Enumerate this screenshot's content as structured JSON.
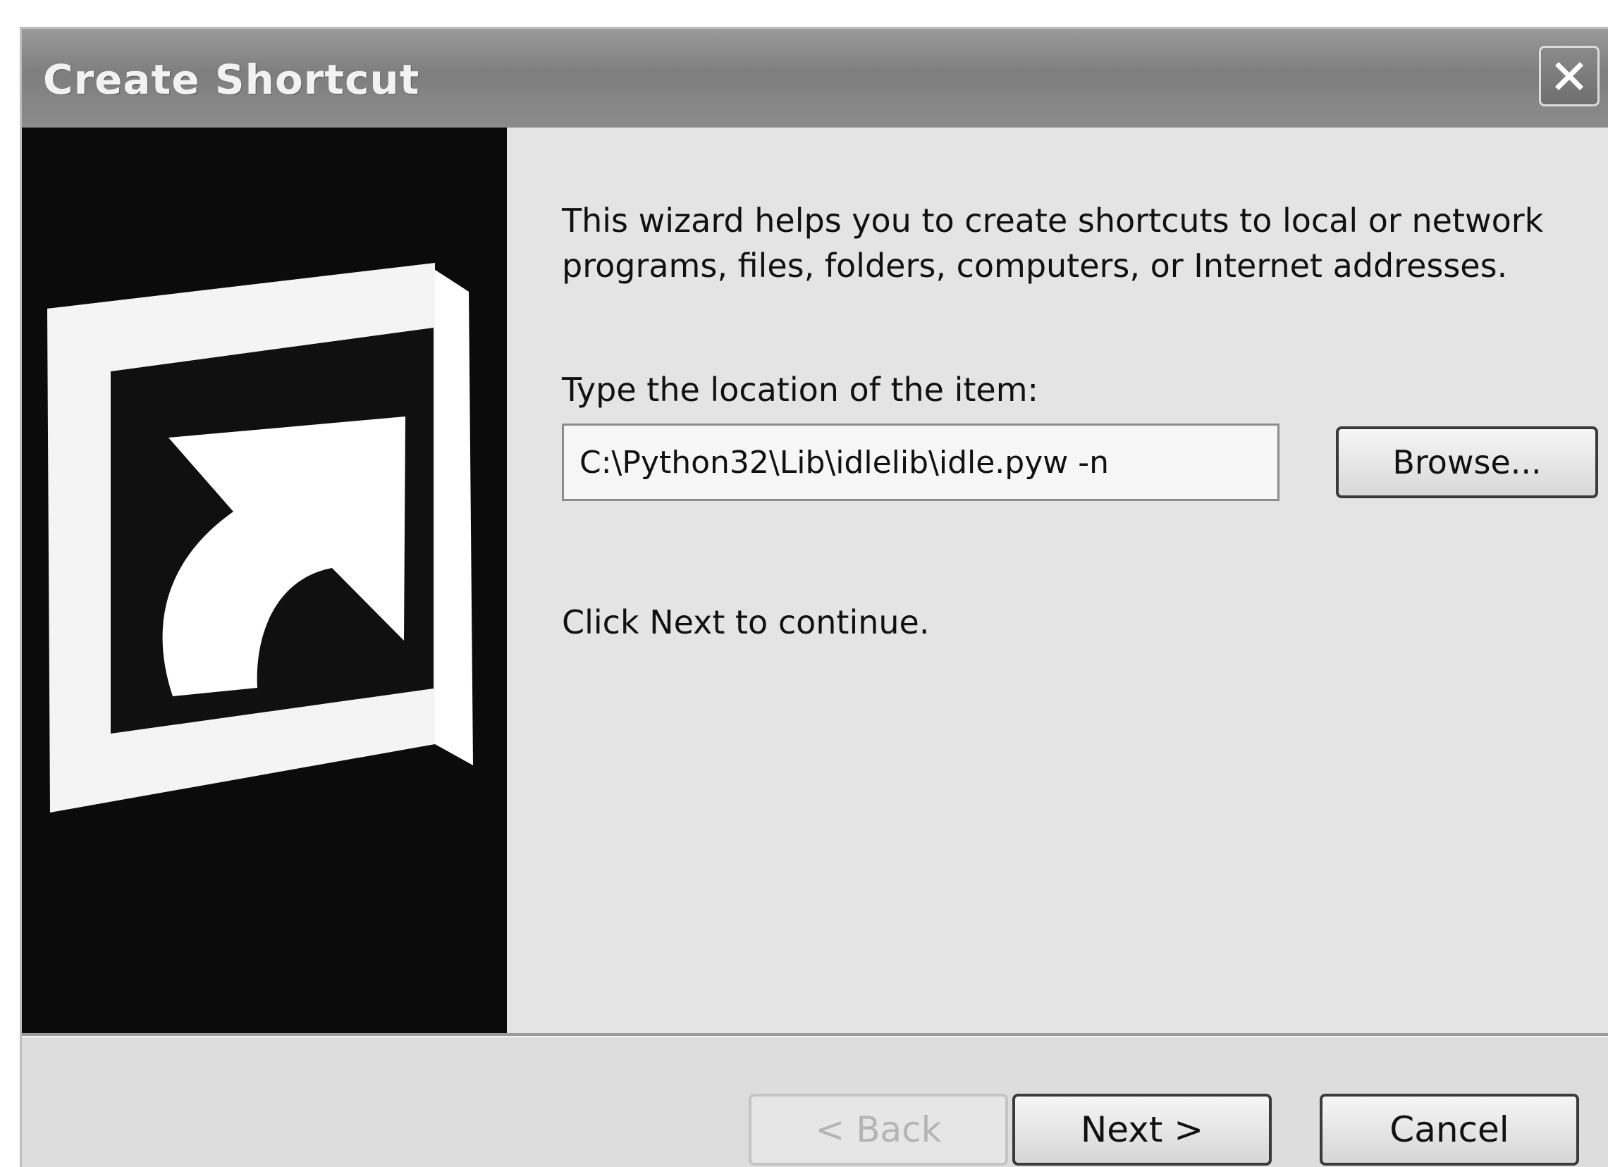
{
  "window": {
    "title": "Create Shortcut",
    "close_icon": "close-icon"
  },
  "sidebar": {
    "icon": "shortcut-arrow-icon"
  },
  "content": {
    "intro": "This wizard helps you to create shortcuts to local or network programs, files, folders, computers, or Internet addresses.",
    "location_label": "Type the location of the item:",
    "location_value": "C:\\Python32\\Lib\\idlelib\\idle.pyw -n",
    "browse_label": "Browse...",
    "continue_text": "Click Next to continue."
  },
  "footer": {
    "back_label": "< Back",
    "next_label": "Next >",
    "cancel_label": "Cancel"
  }
}
